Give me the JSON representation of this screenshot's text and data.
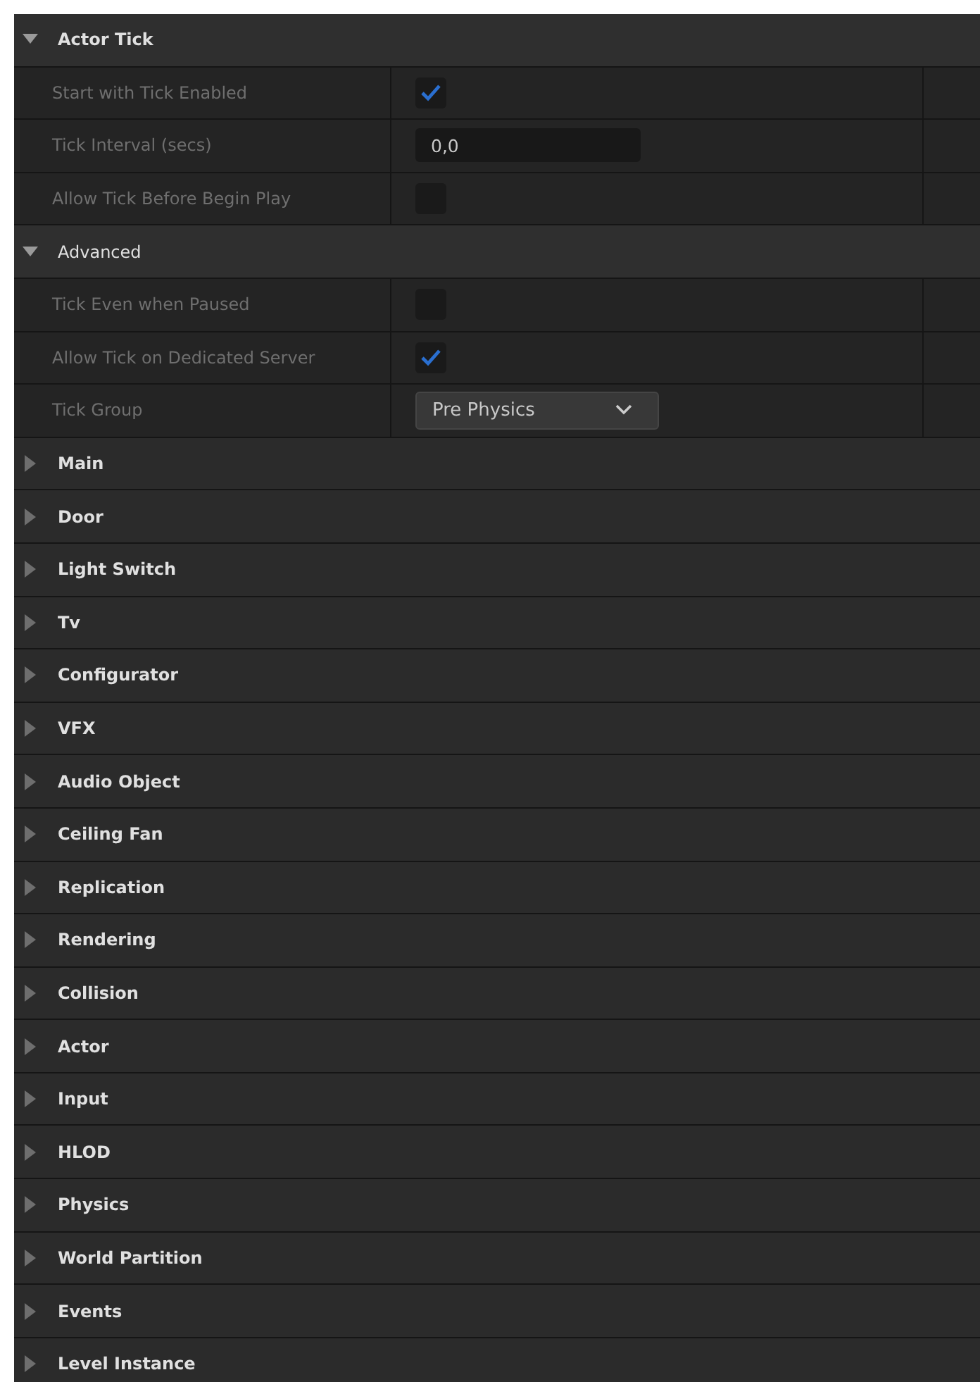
{
  "sections": [
    {
      "title": "Actor Tick",
      "expanded": true,
      "bold": true,
      "rows": [
        {
          "kind": "checkbox",
          "label": "Start with Tick Enabled",
          "checked": true
        },
        {
          "kind": "number",
          "label": "Tick Interval (secs)",
          "value": "0,0"
        },
        {
          "kind": "checkbox",
          "label": "Allow Tick Before Begin Play",
          "checked": false
        }
      ]
    },
    {
      "title": "Advanced",
      "expanded": true,
      "bold": false,
      "rows": [
        {
          "kind": "checkbox",
          "label": "Tick Even when Paused",
          "checked": false
        },
        {
          "kind": "checkbox",
          "label": "Allow Tick on Dedicated Server",
          "checked": true
        },
        {
          "kind": "dropdown",
          "label": "Tick Group",
          "value": "Pre Physics"
        }
      ]
    },
    {
      "title": "Main",
      "expanded": false,
      "bold": true
    },
    {
      "title": "Door",
      "expanded": false,
      "bold": true
    },
    {
      "title": "Light Switch",
      "expanded": false,
      "bold": true
    },
    {
      "title": "Tv",
      "expanded": false,
      "bold": true
    },
    {
      "title": "Configurator",
      "expanded": false,
      "bold": true
    },
    {
      "title": "VFX",
      "expanded": false,
      "bold": true
    },
    {
      "title": "Audio Object",
      "expanded": false,
      "bold": true
    },
    {
      "title": "Ceiling Fan",
      "expanded": false,
      "bold": true
    },
    {
      "title": "Replication",
      "expanded": false,
      "bold": true
    },
    {
      "title": "Rendering",
      "expanded": false,
      "bold": true
    },
    {
      "title": "Collision",
      "expanded": false,
      "bold": true
    },
    {
      "title": "Actor",
      "expanded": false,
      "bold": true
    },
    {
      "title": "Input",
      "expanded": false,
      "bold": true
    },
    {
      "title": "HLOD",
      "expanded": false,
      "bold": true
    },
    {
      "title": "Physics",
      "expanded": false,
      "bold": true
    },
    {
      "title": "World Partition",
      "expanded": false,
      "bold": true
    },
    {
      "title": "Events",
      "expanded": false,
      "bold": true
    },
    {
      "title": "Level Instance",
      "expanded": false,
      "bold": true
    }
  ]
}
